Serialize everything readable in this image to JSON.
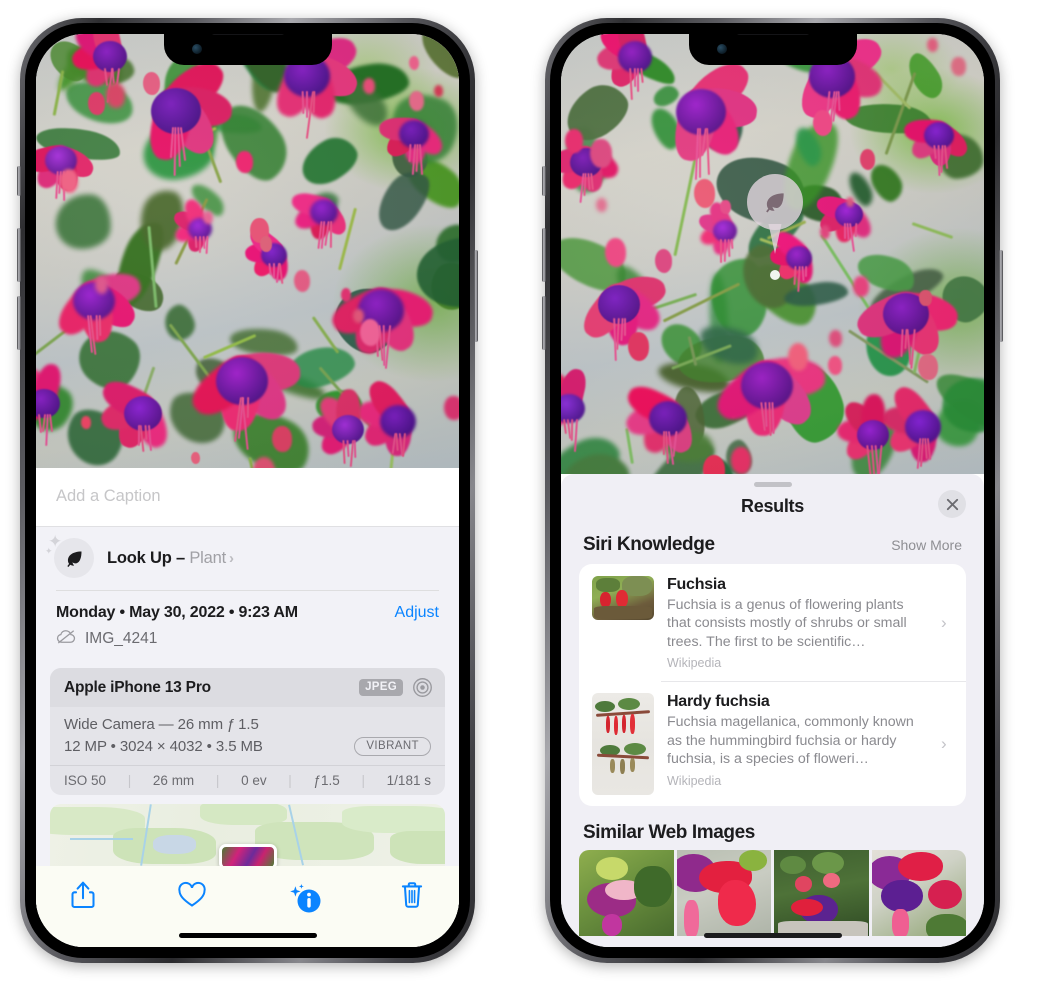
{
  "colors": {
    "accent_blue": "#0a84ff",
    "sheet_bg_left": "#f2f2f7",
    "sheet_bg_right": "#f0eff5",
    "card_grey": "#e4e4e9",
    "muted_text": "#8a8a8f"
  },
  "left_phone": {
    "name": "photos-detail-screen",
    "caption": {
      "placeholder": "Add a Caption",
      "value": ""
    },
    "lookup": {
      "icon": "leaf-icon",
      "label": "Look Up – ",
      "subject": "Plant",
      "chevron": "›"
    },
    "meta": {
      "date": "Monday • May 30, 2022 • 9:23 AM",
      "adjust_label": "Adjust",
      "cloud_icon": "icloud-slash-icon",
      "filename": "IMG_4241"
    },
    "camera_card": {
      "device": "Apple iPhone 13 Pro",
      "format_badge": "JPEG",
      "aperture_icon": "aperture-icon",
      "lens_line": "Wide Camera — 26 mm ƒ 1.5",
      "size_line": "12 MP • 3024 × 4032 • 3.5 MB",
      "quality_badge": "VIBRANT",
      "exif": [
        "ISO 50",
        "26 mm",
        "0 ev",
        "ƒ1.5",
        "1/181 s"
      ]
    },
    "map": {
      "name": "location-map",
      "pin": "photo-pin"
    },
    "toolbar": [
      {
        "name": "share-button",
        "icon": "share-icon"
      },
      {
        "name": "favorite-button",
        "icon": "heart-icon"
      },
      {
        "name": "info-button",
        "icon": "info-sparkle-icon"
      },
      {
        "name": "delete-button",
        "icon": "trash-icon"
      }
    ]
  },
  "right_phone": {
    "name": "visual-lookup-results-screen",
    "marker": {
      "icon": "leaf-icon"
    },
    "sheet": {
      "title": "Results",
      "close_icon": "close-icon"
    },
    "siri_knowledge": {
      "heading": "Siri Knowledge",
      "action": "Show More",
      "items": [
        {
          "title": "Fuchsia",
          "description": "Fuchsia is a genus of flowering plants that consists mostly of shrubs or small trees. The first to be scientific…",
          "source": "Wikipedia",
          "chevron": "›"
        },
        {
          "title": "Hardy fuchsia",
          "description": "Fuchsia magellanica, commonly known as the hummingbird fuchsia or hardy fuchsia, is a species of floweri…",
          "source": "Wikipedia",
          "chevron": "›"
        }
      ]
    },
    "similar_web_images": {
      "heading": "Similar Web Images",
      "count": 4
    }
  }
}
